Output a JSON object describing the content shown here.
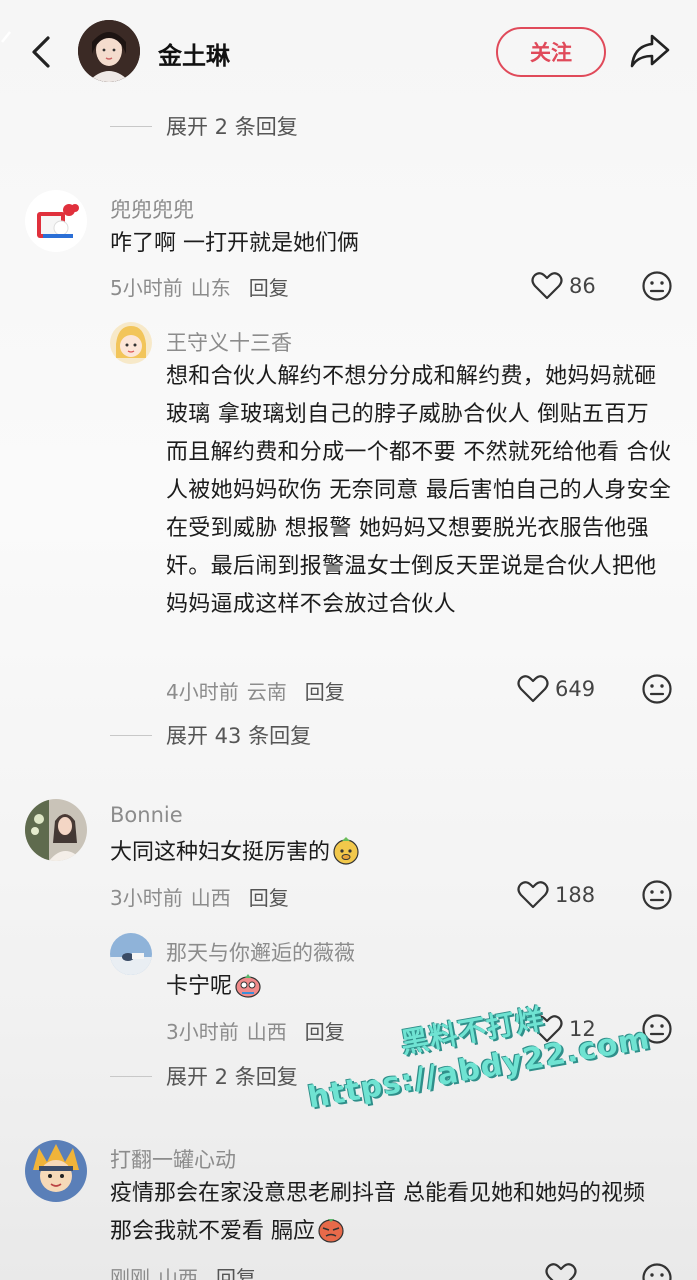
{
  "header": {
    "name": "金土琳",
    "follow_label": "关注"
  },
  "expand_top": {
    "label": "展开 2 条回复"
  },
  "comments": [
    {
      "username": "兜兜兜兜",
      "text": "咋了啊 一打开就是她们俩",
      "time": "5小时前",
      "location": "山东",
      "reply_label": "回复",
      "likes": "86"
    },
    {
      "username": "王守义十三香",
      "text": "想和合伙人解约不想分分成和解约费，她妈妈就砸玻璃 拿玻璃划自己的脖子威胁合伙人 倒贴五百万 而且解约费和分成一个都不要 不然就死给他看 合伙人被她妈妈砍伤 无奈同意 最后害怕自己的人身安全在受到威胁 想报警 她妈妈又想要脱光衣服告他强奸。最后闹到报警温女士倒反天罡说是合伙人把他妈妈逼成这样不会放过合伙人",
      "time": "4小时前",
      "location": "云南",
      "reply_label": "回复",
      "likes": "649"
    },
    {
      "username": "Bonnie",
      "text": "大同这种妇女挺厉害的",
      "time": "3小时前",
      "location": "山西",
      "reply_label": "回复",
      "likes": "188"
    },
    {
      "username": "那天与你邂逅的薇薇",
      "text": "卡宁呢",
      "time": "3小时前",
      "location": "山西",
      "reply_label": "回复",
      "likes": "12"
    },
    {
      "username": "打翻一罐心动",
      "text": "疫情那会在家没意思老刷抖音 总能看见她和她妈的视频 那会我就不爱看 膈应",
      "time": "刚刚",
      "location": "山西",
      "reply_label": "回复"
    }
  ],
  "expand_mid": {
    "label": "展开 43 条回复"
  },
  "expand_low": {
    "label": "展开 2 条回复"
  },
  "watermark": {
    "line1": "黑料不打烊",
    "line2": "https://abdy22.com"
  },
  "colors": {
    "accent": "#e04a5a",
    "muted": "#8c8c8c",
    "watermark": "#6fe3d2"
  }
}
